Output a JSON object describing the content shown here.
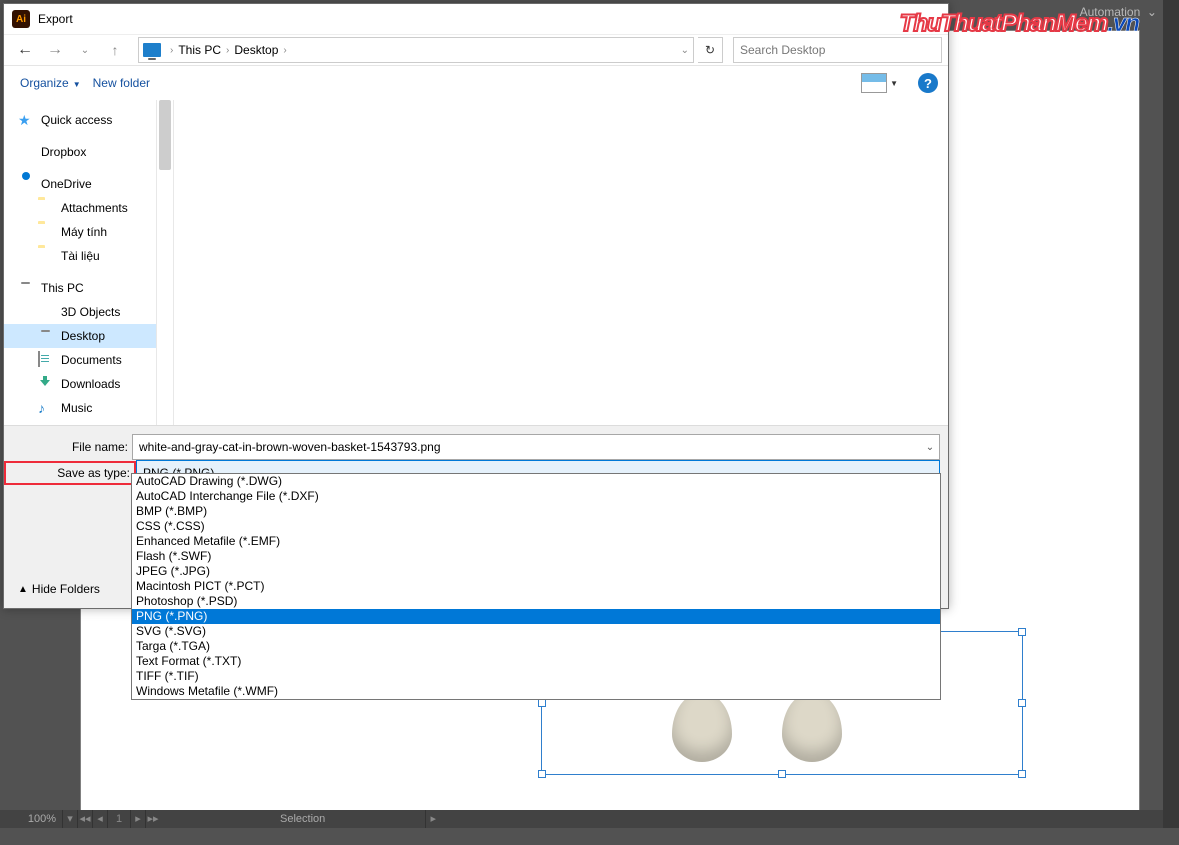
{
  "ai": {
    "automation_menu": "Automation",
    "zoom": "100%",
    "artboard_num": "1",
    "status_text": "Selection"
  },
  "watermark": {
    "a": "ThuThuatPhanMem",
    "b": ".vn"
  },
  "dialog": {
    "title": "Export",
    "nav": {
      "breadcrumb": {
        "root": "This PC",
        "current": "Desktop"
      },
      "search_placeholder": "Search Desktop"
    },
    "toolbar": {
      "organize": "Organize",
      "new_folder": "New folder"
    },
    "tree": {
      "quick_access": "Quick access",
      "dropbox": "Dropbox",
      "onedrive": "OneDrive",
      "attachments": "Attachments",
      "may_tinh": "Máy tính",
      "tai_lieu": "Tài liệu",
      "this_pc": "This PC",
      "objects_3d": "3D Objects",
      "desktop": "Desktop",
      "documents": "Documents",
      "downloads": "Downloads",
      "music": "Music"
    },
    "bottom": {
      "file_name_label": "File name:",
      "file_name_value": "white-and-gray-cat-in-brown-woven-basket-1543793.png",
      "save_type_label": "Save as type:",
      "save_type_value": "PNG (*.PNG)",
      "hide_folders": "Hide Folders"
    }
  },
  "dropdown_options": [
    "AutoCAD Drawing (*.DWG)",
    "AutoCAD Interchange File (*.DXF)",
    "BMP (*.BMP)",
    "CSS (*.CSS)",
    "Enhanced Metafile (*.EMF)",
    "Flash (*.SWF)",
    "JPEG (*.JPG)",
    "Macintosh PICT (*.PCT)",
    "Photoshop (*.PSD)",
    "PNG (*.PNG)",
    "SVG (*.SVG)",
    "Targa (*.TGA)",
    "Text Format (*.TXT)",
    "TIFF (*.TIF)",
    "Windows Metafile (*.WMF)"
  ],
  "dropdown_selected_index": 9
}
